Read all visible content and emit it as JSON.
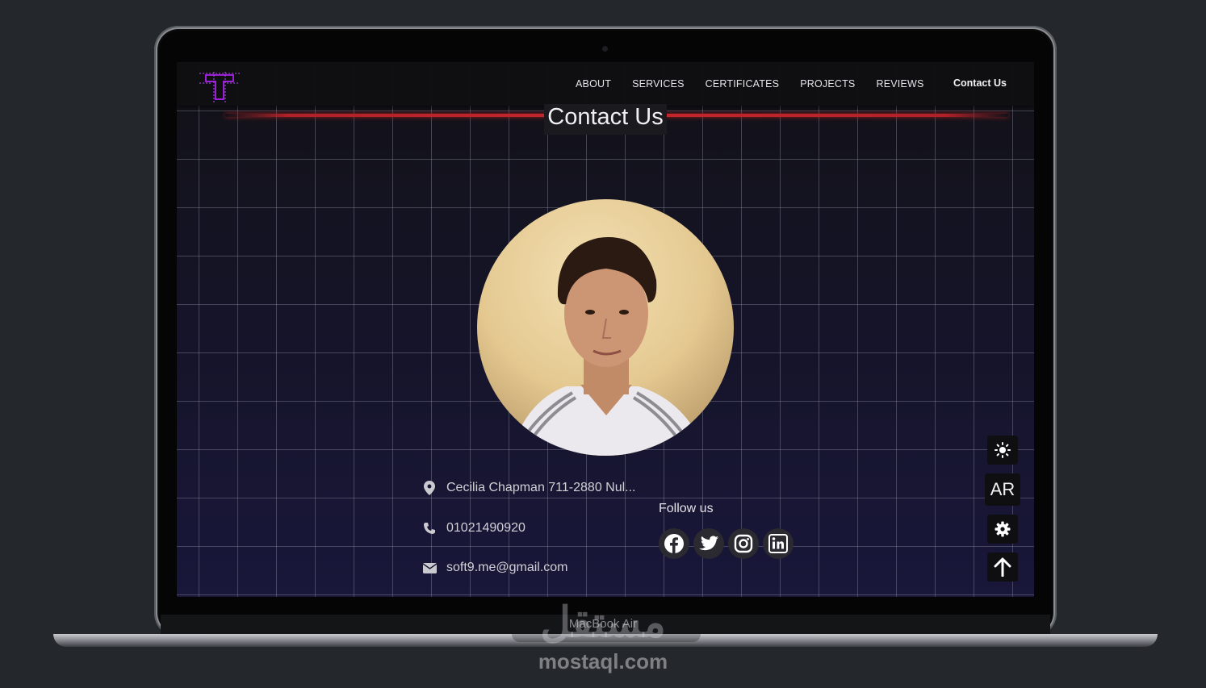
{
  "device": {
    "model_label": "MacBook Air"
  },
  "watermark": {
    "arabic_text": "مستقل",
    "latin_text": "mostaql.com"
  },
  "navbar": {
    "logo": "T-logo-icon",
    "links": [
      {
        "label": "ABOUT"
      },
      {
        "label": "SERVICES"
      },
      {
        "label": "CERTIFICATES"
      },
      {
        "label": "PROJECTS"
      },
      {
        "label": "REVIEWS"
      }
    ],
    "contact_label": "Contact Us",
    "accent": "#9b1fd6"
  },
  "page": {
    "title": "Contact Us",
    "title_accent": "#c8262c"
  },
  "contact": {
    "address": "Cecilia Chapman 711-2880 Nul...",
    "phone": "01021490920",
    "email": "soft9.me@gmail.com"
  },
  "follow": {
    "title": "Follow us",
    "networks": [
      {
        "icon": "facebook-icon"
      },
      {
        "icon": "twitter-icon"
      },
      {
        "icon": "instagram-icon"
      },
      {
        "icon": "linkedin-icon"
      }
    ]
  },
  "side_controls": {
    "theme_icon": "sun-icon",
    "language_label": "AR",
    "settings_icon": "gear-icon",
    "scroll_top_icon": "arrow-up-icon"
  }
}
